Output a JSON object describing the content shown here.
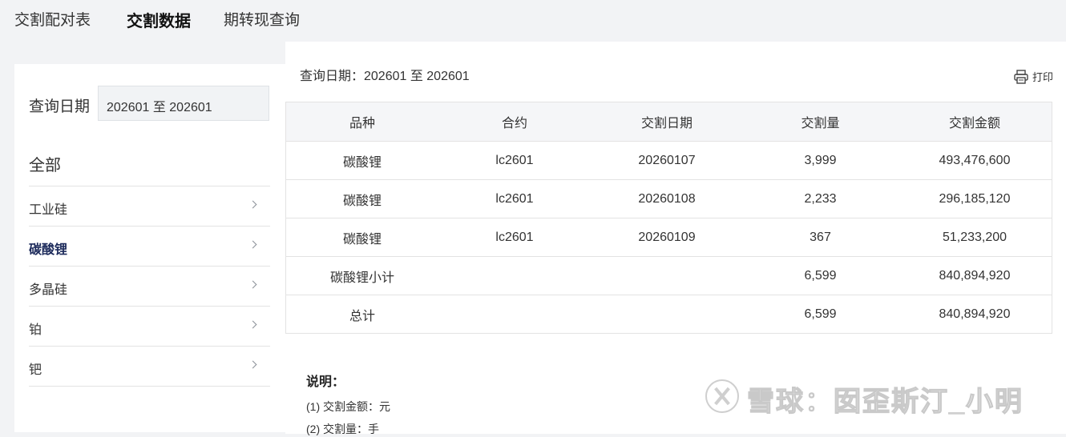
{
  "tabs": [
    {
      "label": "交割配对表",
      "active": false
    },
    {
      "label": "交割数据",
      "active": true
    },
    {
      "label": "期转现查询",
      "active": false
    }
  ],
  "sidebar": {
    "query_label": "查询日期",
    "query_value": "202601 至 202601",
    "all_label": "全部",
    "items": [
      {
        "label": "工业硅",
        "active": false
      },
      {
        "label": "碳酸锂",
        "active": true
      },
      {
        "label": "多晶硅",
        "active": false
      },
      {
        "label": "铂",
        "active": false
      },
      {
        "label": "钯",
        "active": false
      }
    ]
  },
  "main": {
    "date_text": "查询日期：202601 至 202601",
    "print_label": "打印",
    "table": {
      "headers": [
        "品种",
        "合约",
        "交割日期",
        "交割量",
        "交割金额"
      ],
      "rows": [
        [
          "碳酸锂",
          "lc2601",
          "20260107",
          "3,999",
          "493,476,600"
        ],
        [
          "碳酸锂",
          "lc2601",
          "20260108",
          "2,233",
          "296,185,120"
        ],
        [
          "碳酸锂",
          "lc2601",
          "20260109",
          "367",
          "51,233,200"
        ],
        [
          "碳酸锂小计",
          "",
          "",
          "6,599",
          "840,894,920"
        ],
        [
          "总计",
          "",
          "",
          "6,599",
          "840,894,920"
        ]
      ]
    },
    "notes_title": "说明：",
    "notes": [
      "(1) 交割金额：元",
      "(2) 交割量：手"
    ]
  },
  "watermark": "雪球：囡歪斯汀_小明",
  "icons": {
    "print": "printer-icon",
    "chevron": "chevron-right-icon",
    "watermark_logo": "xueqiu-logo"
  }
}
